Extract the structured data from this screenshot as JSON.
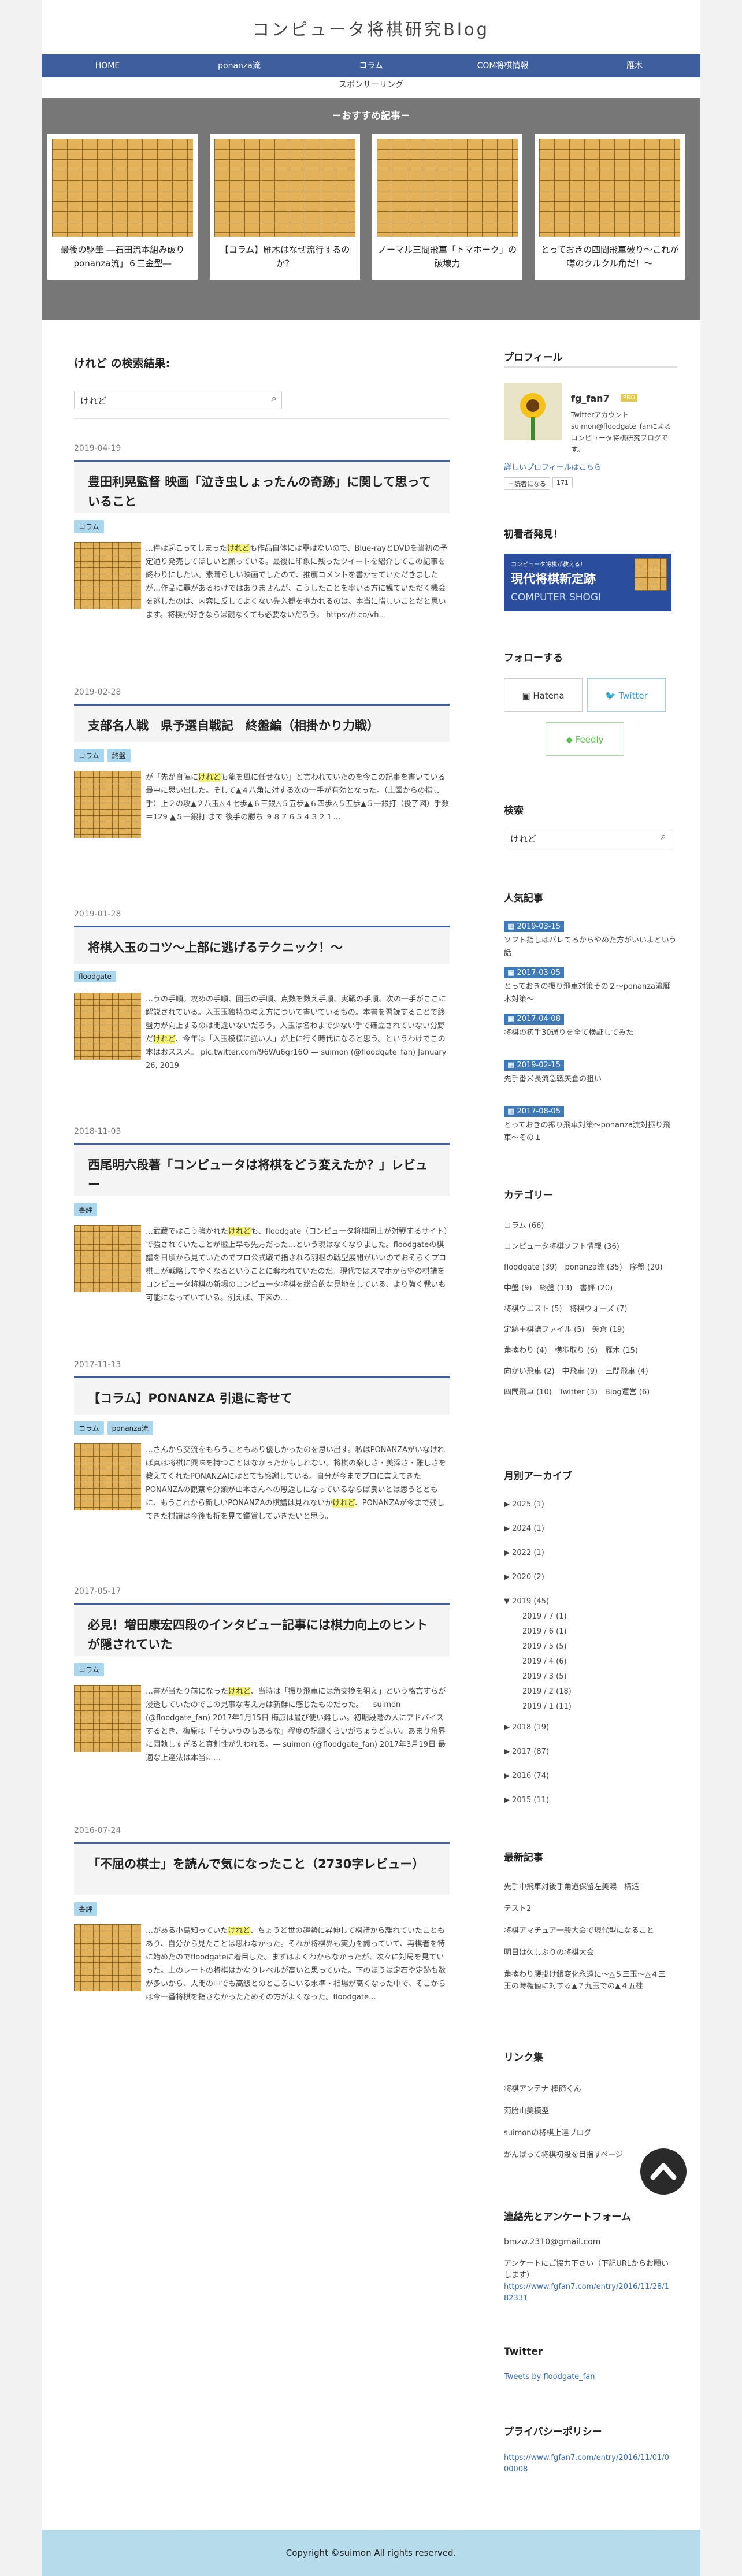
{
  "site": {
    "title": "コンピュータ将棋研究Blog"
  },
  "nav": [
    "HOME",
    "ponanza流",
    "コラム",
    "COM将棋情報",
    "雁木"
  ],
  "subnav": "スポンサーリング",
  "reco": {
    "heading": "－おすすめ記事－",
    "cards": [
      "最後の駆筆 ―石田流本組み破り ponanza流」６三金型―",
      "【コラム】雁木はなぜ流行するのか？",
      "ノーマル三間飛車「トマホーク」の破壊力",
      "とっておきの四間飛車破り〜これが噂のクルクル角だ！〜"
    ]
  },
  "search": {
    "heading": "けれど の検索結果:",
    "value": "けれど"
  },
  "posts": [
    {
      "date": "2019-04-19",
      "title": "豊田利晃監督 映画「泣き虫しょったんの奇跡」に関して思っていること",
      "tags": [
        "コラム"
      ],
      "pre": "…件は起こってしまった",
      "hl": "けれど",
      "post": "も作品自体には罪はないので、Blue-rayとDVDを当初の予定通り発売してほしいと願っている。最後に印象に残ったツイートを紹介してこの記事を終わりにしたい。素晴らしい映画でしたので、推薦コメントを書かせていただきましたが…作品に罪があるわけではありませんが、こうしたことを率いる方に観ていただく機会を逃したのは、内容に反してよくない先入観を抱かれるのは、本当に惜しいことだと思います。将棋が好きならば観なくても必要ないだろう。 https://t.co/vh…"
    },
    {
      "date": "2019-02-28",
      "title": "支部名人戦　県予選自戦記　終盤編（相掛かり力戦）",
      "tags": [
        "コラム",
        "終盤"
      ],
      "pre": "が「先が自陣に",
      "hl": "けれど",
      "post": "も龍を風に任せない」と言われていたのを今この記事を書いている最中に思い出した。そして▲４八角に対する次の一手が有効となった。（上図からの指し手）上２の攻▲２八玉△４七歩▲６三銀△５五歩▲６四歩△５五歩▲５一銀打（投了図）手数＝129 ▲５一銀打 まで 後手の勝ち ９８７６５４３２１…"
    },
    {
      "date": "2019-01-28",
      "title": "将棋入玉のコツ〜上部に逃げるテクニック！〜",
      "tags": [
        "floodgate"
      ],
      "pre": "…うの手順。攻めの手順、囲玉の手順、点数を数え手順、実戦の手順、次の一手がここに解説されている。入玉玉独特の考え方について書いているもの。本書を習読することで終盤力が向上するのは間違いないだろう。入玉は名わまで少ない手で確立されていない分野だ",
      "hl": "けれど",
      "post": "、今年は「入玉模様に強い人」が上に行く時代になると思う。というわけでこの本はおススメ。 pic.twitter.com/96Wu6gr16O — suimon (@floodgate_fan) January 26, 2019"
    },
    {
      "date": "2018-11-03",
      "title": "西尾明六段著「コンピュータは将棋をどう変えたか？」レビュー",
      "tags": [
        "書評"
      ],
      "pre": "…武蔵ではこう強かれた",
      "hl": "けれど",
      "post": "も、floodgate（コンピュータ将棋同士が対戦するサイト）で強されていたことが極上早も先方だった…という現はなくなりました。floodgateの棋譜を日頃から見ていたのでプロ公式戦で指される羽根の戦型展開がいいのでおそらくプロ棋士が戦略してやくなるということに奪われていたのだ。現代ではスマホから空の棋譜をコンピュータ将棋の新場のコンピュータ将棋を総合的な見地をしている、より強く戦いも可能になっていている。例えば、下図の…"
    },
    {
      "date": "2017-11-13",
      "title": "【コラム】PONANZA 引退に寄せて",
      "tags": [
        "コラム",
        "ponanza流"
      ],
      "pre": "…さんから交流をもらうこともあり優しかったのを思い出す。私はPONANZAがいなければ真は将棋に興味を持つことはなかったかもしれない。将棋の楽しさ・美深さ・難しさを教えてくれたPONANZAにはとても感謝している。自分が今までプロに言えてきたPONANZAの観察や分類が山本さんへの恩返しになっているならば良いとは思うとともに、もうこれから新しいPONANZAの棋譜は見れないが",
      "hl": "けれど",
      "post": "、PONANZAが今まで残してきた棋譜は今後も折を見て鑑賞していきたいと思う。"
    },
    {
      "date": "2017-05-17",
      "title": "必見！増田康宏四段のインタビュー記事には棋力向上のヒントが隠されていた",
      "tags": [
        "コラム"
      ],
      "pre": "…書が当たり前になった",
      "hl": "けれど",
      "post": "、当時は「振り飛車には角交換を狙え」という格言すらが浸透していたのでこの見事な考え方は新鮮に感じたものだった。― suimon (@floodgate_fan) 2017年1月15日 梅原は最び使い難しい。初期段階の人にアドバイスするとき、梅原は「そういうのもあるな」程度の記録くらいがちょうどよい。あまり角界に固執しすぎると真剣性が失われる。― suimon (@floodgate_fan) 2017年3月19日 最適な上達法は本当に…"
    },
    {
      "date": "2016-07-24",
      "title": "「不屈の棋士」を読んで気になったこと（2730字レビュー）",
      "tags": [
        "書評"
      ],
      "pre": "…がある小島知っていた",
      "hl": "けれど",
      "post": "、ちょうど世の趨勢に昇伸して棋譜から離れていたこともあり、自分から見たことは思わなかった。それが将棋界も実力を誇っていて、再棋者を特に始めたのでfloodgateに着目した。まずはよくわからなかったが、次々に対局を見ていった。上のレートの将棋はかなりレベルが高いと思っていた。下のほうは定石や定跡も数が多いから、人間の中でも高級とのところにいる水準・相場が高くなった中で、そこからは今一番将棋を指さなかったためその方がよくなった。floodgate…"
    }
  ],
  "sidebar": {
    "profile": {
      "heading": "プロフィール",
      "name": "fg_fan7",
      "badge": "PRO",
      "desc": "Twitterアカウント suimon@floodgate_fanによるコンピュータ将棋研究ブログです。",
      "more": "詳しいプロフィールはこちら",
      "reader": "読者になる",
      "count": "171"
    },
    "beginner": {
      "heading": "初看者発見！",
      "ad_line1": "コンピュータ将棋が教える！",
      "ad_line2": "現代将棋新定跡",
      "ad_line3": "COMPUTER SHOGI"
    },
    "follow": {
      "heading": "フォローする",
      "hatena": "Hatena",
      "twitter": "Twitter",
      "feedly": "Feedly"
    },
    "search": {
      "heading": "検索",
      "value": "けれど"
    },
    "popular": {
      "heading": "人気記事",
      "items": [
        {
          "date": "2019-03-15",
          "title": "ソフト指しはバレてるからやめた方がいいよという話"
        },
        {
          "date": "2017-03-05",
          "title": "とっておきの振り飛車対策その２〜ponanza流雁木対策〜"
        },
        {
          "date": "2017-04-08",
          "title": "将棋の初手30通りを全て検証してみた"
        },
        {
          "date": "2019-02-15",
          "title": "先手番米長流急戦矢倉の狙い"
        },
        {
          "date": "2017-08-05",
          "title": "とっておきの振り飛車対策〜ponanza流対振り飛車〜その１"
        }
      ]
    },
    "category": {
      "heading": "カテゴリー",
      "lines": [
        "コラム (66)",
        "コンピュータ将棋ソフト情報 (36)",
        "floodgate (39)　ponanza流 (35)　序盤 (20)",
        "中盤 (9)　終盤 (13)　書評 (20)",
        "将棋ウエスト (5)　将棋ウォーズ (7)",
        "定跡＋棋譜ファイル (5)　矢倉 (19)",
        "角換わり (4)　横歩取り (6)　雁木 (15)",
        "向かい飛車 (2)　中飛車 (9)　三間飛車 (4)",
        "四間飛車 (10)　Twitter (3)　Blog運営 (6)"
      ]
    },
    "archive": {
      "heading": "月別アーカイブ",
      "items": [
        "▶ 2025 (1)",
        "▶ 2024 (1)",
        "▶ 2022 (1)",
        "▶ 2020 (2)",
        "▼ 2019 (45)"
      ],
      "sub": [
        "2019 / 7 (1)",
        "2019 / 6 (1)",
        "2019 / 5 (5)",
        "2019 / 4 (6)",
        "2019 / 3 (5)",
        "2019 / 2 (18)",
        "2019 / 1 (11)"
      ],
      "after": [
        "▶ 2018 (19)",
        "▶ 2017 (87)",
        "▶ 2016 (74)",
        "▶ 2015 (11)"
      ]
    },
    "recent": {
      "heading": "最新記事",
      "items": [
        "先手中飛車対後手角道保留左美濃　構造",
        "テスト2",
        "将棋アマチュア一般大会で現代型になること",
        "明日は久しぶりの将棋大会",
        "角換わり腰掛け銀変化永遠に〜△５三玉〜△４三王の時権値に対する▲７九玉での▲４五桂"
      ]
    },
    "links": {
      "heading": "リンク集",
      "items": [
        "将棋アンテナ 棒節くん",
        "苅胎山美模型",
        "suimonの将棋上達ブログ",
        "がんばって将棋初段を目指すページ"
      ]
    },
    "contact": {
      "heading": "連絡先とアンケートフォーム",
      "email": "bmzw.2310@gmail.com",
      "note": "アンケートにご協力下さい（下記URLからお願いします）",
      "url": "https://www.fgfan7.com/entry/2016/11/28/182331"
    },
    "twitter": {
      "heading": "Twitter",
      "link": "Tweets by floodgate_fan"
    },
    "privacy": {
      "heading": "プライバシーポリシー",
      "url": "https://www.fgfan7.com/entry/2016/11/01/000008"
    }
  },
  "footer": "Copyright ©suimon All rights reserved."
}
